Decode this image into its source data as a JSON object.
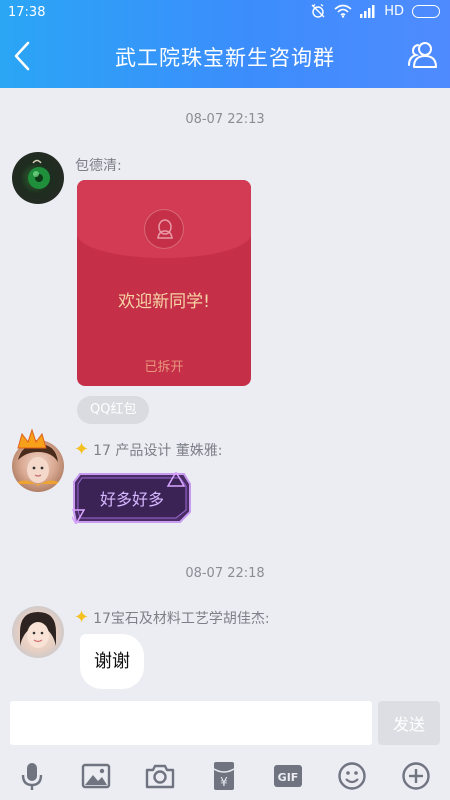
{
  "status_bar": {
    "time": "17:38",
    "network": "HD"
  },
  "header": {
    "title": "武工院珠宝新生咨询群"
  },
  "chat": {
    "messages": [
      {
        "timestamp": "08-07 22:13"
      },
      {
        "sender": "包德清:",
        "type": "red_packet",
        "greeting": "欢迎新同学!",
        "state": "已拆开",
        "tag": "QQ红包"
      },
      {
        "sender": "17 产品设计 董姝雅:",
        "type": "sticker",
        "sticker_text": "好多好多"
      },
      {
        "timestamp": "08-07 22:18"
      },
      {
        "sender": "17宝石及材料工艺学胡佳杰:",
        "type": "text",
        "text": "谢谢"
      }
    ]
  },
  "input": {
    "value": "",
    "send_label": "发送"
  },
  "toolbar": {
    "items": [
      "microphone-icon",
      "image-icon",
      "camera-icon",
      "red-packet-icon",
      "gif-icon",
      "emoji-icon",
      "plus-icon"
    ],
    "gif_label": "GIF",
    "red_packet_glyph": "¥"
  },
  "colors": {
    "header_start": "#2aa6f5",
    "header_end": "#4f8bff",
    "red_packet": "#c53048",
    "background": "#ebedf2"
  }
}
